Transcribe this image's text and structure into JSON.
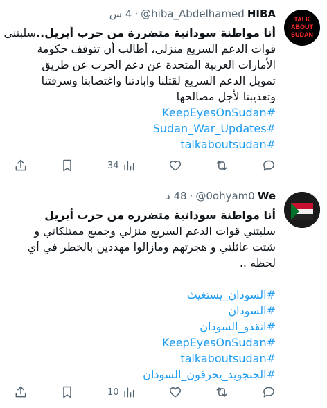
{
  "colors": {
    "link": "#1d9bf0",
    "secondary": "#536471",
    "divider": "#cfd9de"
  },
  "tweets": [
    {
      "avatar_icon": "talk-about-sudan-logo",
      "avatar_lines": [
        "TALK",
        "ABOUT",
        "SUDAN"
      ],
      "name": "HIBA",
      "handle": "@hiba_Abdelhamed",
      "dot": "·",
      "time": "4 س",
      "body": [
        {
          "text": "أنا مواطنة سودانية متضررة من حرب أبريل..",
          "bold": true,
          "after": "سلبتني"
        },
        {
          "text": "قوات الدعم السريع منزلي، أطالب أن تتوقف حكومة"
        },
        {
          "text": "الأمارات العربية المتحدة عن دعم الحرب عن طريق"
        },
        {
          "text": "تمويل الدعم السريع لقتلنا وابادتنا واغتصابنا وسرقتنا"
        },
        {
          "text": "وتعذيبنا لأجل مصالحها"
        }
      ],
      "hashtags": [
        "#KeepEyesOnSudan",
        "#Sudan_War_Updates",
        "#talkaboutsudan"
      ],
      "views": "34"
    },
    {
      "avatar_icon": "sudan-flag-avatar",
      "name": "We",
      "handle": "@0ohyam0",
      "dot": "·",
      "time": "48 د",
      "body": [
        {
          "text": "أنا مواطنة سودانية متضرره من حرب أبريل",
          "bold": true
        },
        {
          "text": "سلبتني قوات الدعم السريع منزلي وجميع ممتلكاتي و"
        },
        {
          "text": "شتت عائلتي و هجرتهم ومازالوا مهددين بالخطر في أي"
        },
        {
          "text": "لحظه .."
        }
      ],
      "hashtags": [
        "#السودان_يستغيث",
        "#السودان",
        "#انقذو_السودان",
        "#KeepEyesOnSudan",
        "#talkaboutsudan",
        "#الجنجويد_يحرقون_السودان"
      ],
      "views": "10"
    }
  ]
}
